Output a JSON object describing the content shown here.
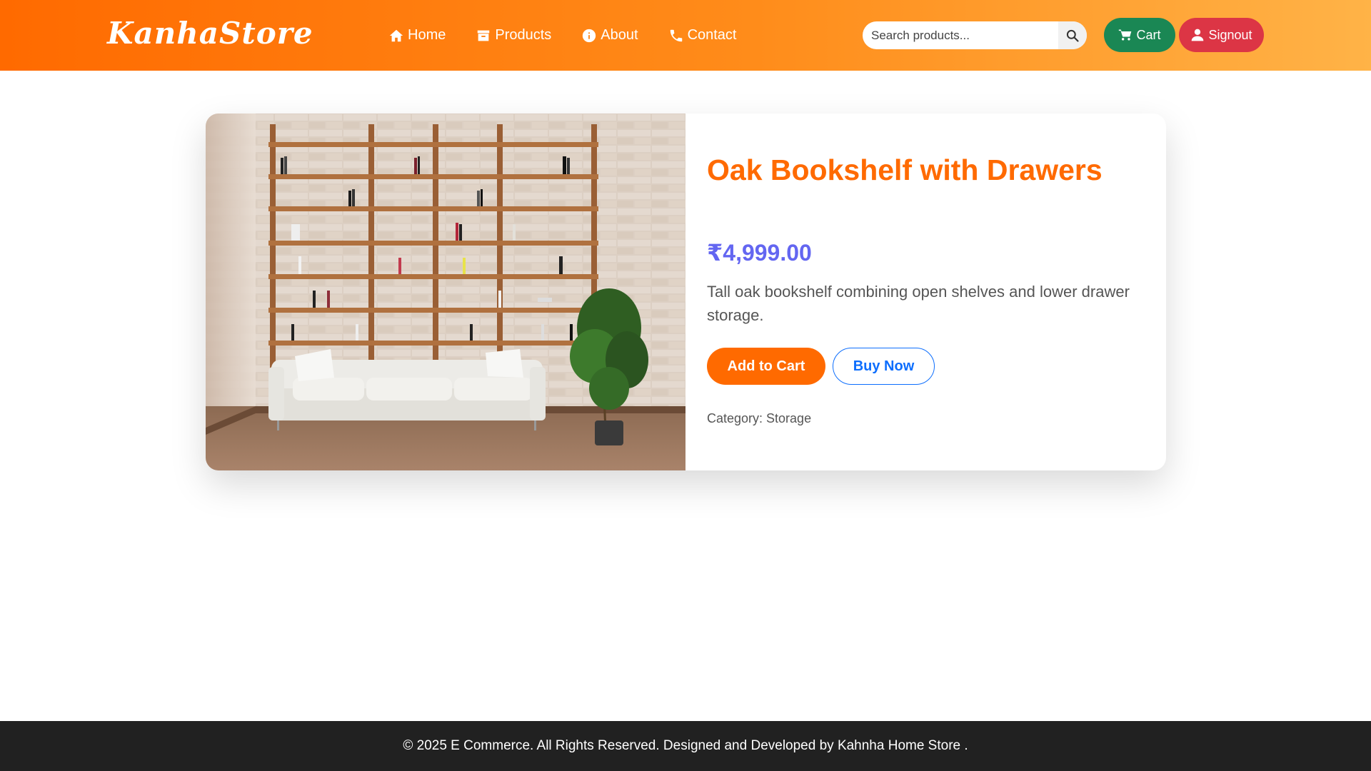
{
  "header": {
    "brand": "KanhaStore",
    "nav": [
      {
        "label": "Home",
        "icon": "home-icon"
      },
      {
        "label": "Products",
        "icon": "box-icon"
      },
      {
        "label": "About",
        "icon": "info-icon"
      },
      {
        "label": "Contact",
        "icon": "phone-icon"
      }
    ],
    "search": {
      "placeholder": "Search products...",
      "value": ""
    },
    "cart_label": "Cart",
    "signout_label": "Signout"
  },
  "product": {
    "title": "Oak Bookshelf with Drawers",
    "price": "₹4,999.00",
    "description": "Tall oak bookshelf combining open shelves and lower drawer storage.",
    "add_to_cart_label": "Add to Cart",
    "buy_now_label": "Buy Now",
    "category_label": "Category: Storage"
  },
  "footer": {
    "text": "© 2025 E Commerce. All Rights Reserved. Designed and Developed by Kahnha Home Store ."
  },
  "colors": {
    "header_gradient_start": "#ff6a00",
    "header_gradient_end": "#ffb347",
    "title": "#ff6a00",
    "price": "#6366f1",
    "cart_button": "#1a8754",
    "signout_button": "#dc3545",
    "buy_now": "#0d6efd",
    "footer_bg": "#212121"
  }
}
